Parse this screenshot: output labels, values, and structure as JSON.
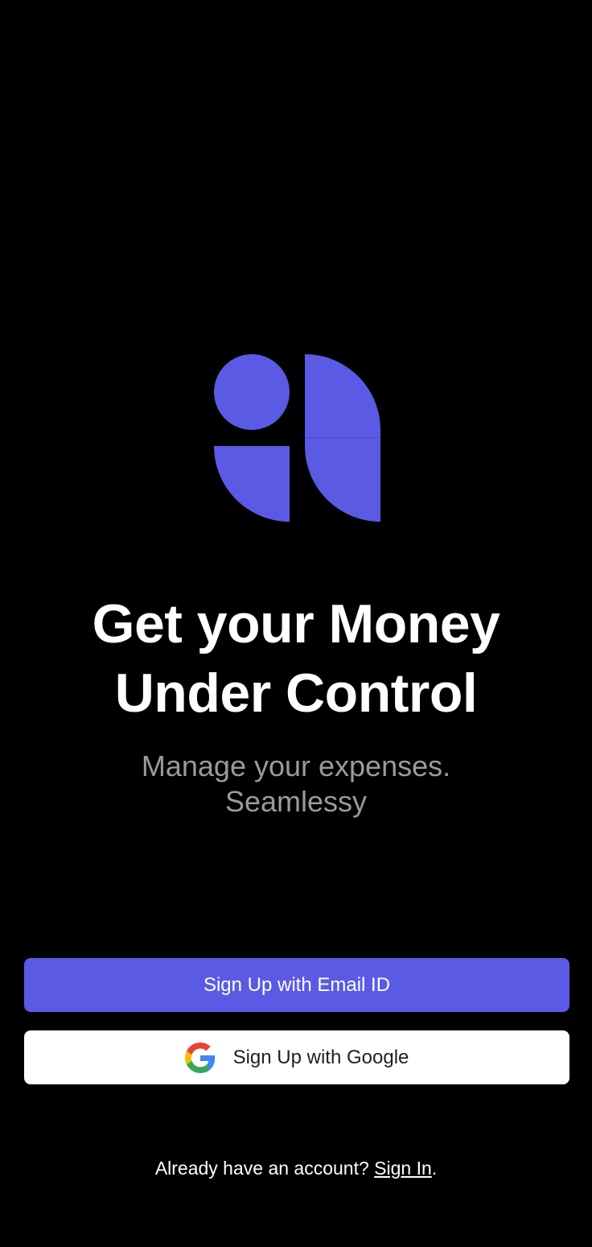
{
  "brand": {
    "logo_icon": "brand-logo-icon",
    "accent_color": "#5b5ae4"
  },
  "hero": {
    "title_line1": "Get your Money",
    "title_line2": "Under Control",
    "subtitle_line1": "Manage your expenses.",
    "subtitle_line2": "Seamlessy"
  },
  "actions": {
    "email_signup_label": "Sign Up with Email ID",
    "google_signup_label": "Sign Up with Google",
    "google_icon": "google-g-icon"
  },
  "footer": {
    "prompt": "Already have an account?",
    "signin_label": "Sign In",
    "suffix": "."
  }
}
